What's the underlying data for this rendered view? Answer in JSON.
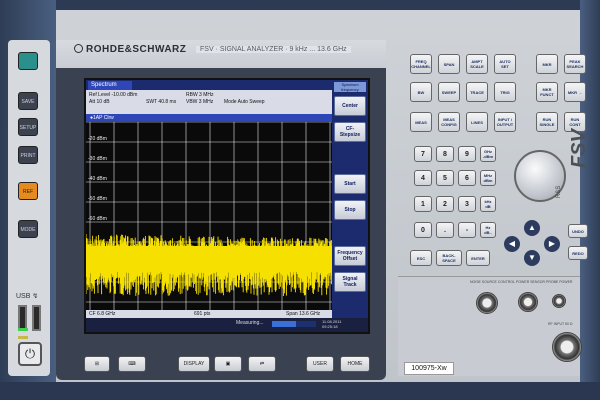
{
  "brand": {
    "name": "ROHDE&SCHWARZ",
    "model_line": "FSV  ·  SIGNAL ANALYZER  ·  9 kHz ... 13.6 GHz",
    "side_logo": "FSV",
    "side_text": "R&S"
  },
  "screen": {
    "tab": "Spectrum",
    "info": {
      "ref_level": "Ref Level  -10.00 dBm",
      "att": "Att           10 dB",
      "swt": "SWT  40.8 ms",
      "rbw": "RBW  3 MHz",
      "vbw": "VBW  3 MHz",
      "mode": "Mode  Auto Sweep"
    },
    "trace_label": "●1AP Clrw",
    "y_ticks": [
      "-20 dBm",
      "-30 dBm",
      "-40 dBm",
      "-50 dBm",
      "-60 dBm"
    ],
    "footer": {
      "cf": "CF 6.8 GHz",
      "pts": "691 pts",
      "span": "Span 13.6 GHz"
    },
    "status": {
      "measuring": "Measuring...",
      "date": "11.08.2011",
      "time": "09:25:18"
    },
    "softkeys_title": "Spectrum\nfrequency",
    "softkeys": [
      "Center",
      "CF-\nStepsize",
      "",
      "Start",
      "Stop",
      "",
      "Frequency\nOffset",
      "Signal\nTrack"
    ]
  },
  "bezel_buttons": [
    "⊞",
    "⌨",
    "DISPLAY",
    "▣",
    "⇄",
    "USER",
    "HOME"
  ],
  "left_buttons": [
    "",
    "SAVE\nRCL",
    "SETUP",
    "PRINT",
    "REF",
    "MODE"
  ],
  "usb_label": "USB ↯",
  "keypad": {
    "row1": [
      "FREQ\nCHANNEL",
      "SPAN",
      "AMPT\nSCALE",
      "AUTO\nSET",
      "MKR",
      "PEAK\nSEARCH"
    ],
    "row2": [
      "BW",
      "SWEEP",
      "TRACE",
      "TRIG",
      "MKR\nFUNCT",
      "MKR →"
    ],
    "row3": [
      "MEAS",
      "MEAS\nCONFIG",
      "LINES",
      "INPUT /\nOUTPUT",
      "RUN\nSINGLE",
      "RUN\nCONT"
    ],
    "numpad": [
      "7",
      "8",
      "9",
      "4",
      "5",
      "6",
      "1",
      "2",
      "3",
      "0",
      ".",
      "-"
    ],
    "units": [
      "GHz\n-dBm",
      "MHz\ndBm",
      "kHz\ndB",
      "Hz\ndB.."
    ],
    "bottom": [
      "ESC",
      "BACK-\nSPACE",
      "ENTER"
    ],
    "side": [
      "UNDO",
      "REDO"
    ]
  },
  "connectors": {
    "noise": "NOISE SOURCE CONTROL",
    "power": "POWER SENSOR",
    "probe": "PROBE POWER",
    "rf": "RF INPUT 50 Ω"
  },
  "serial": "100975-Xw",
  "colors": {
    "trace": "#f5e000",
    "screen_header": "#1c2b6e",
    "softkey_text": "#142060"
  }
}
